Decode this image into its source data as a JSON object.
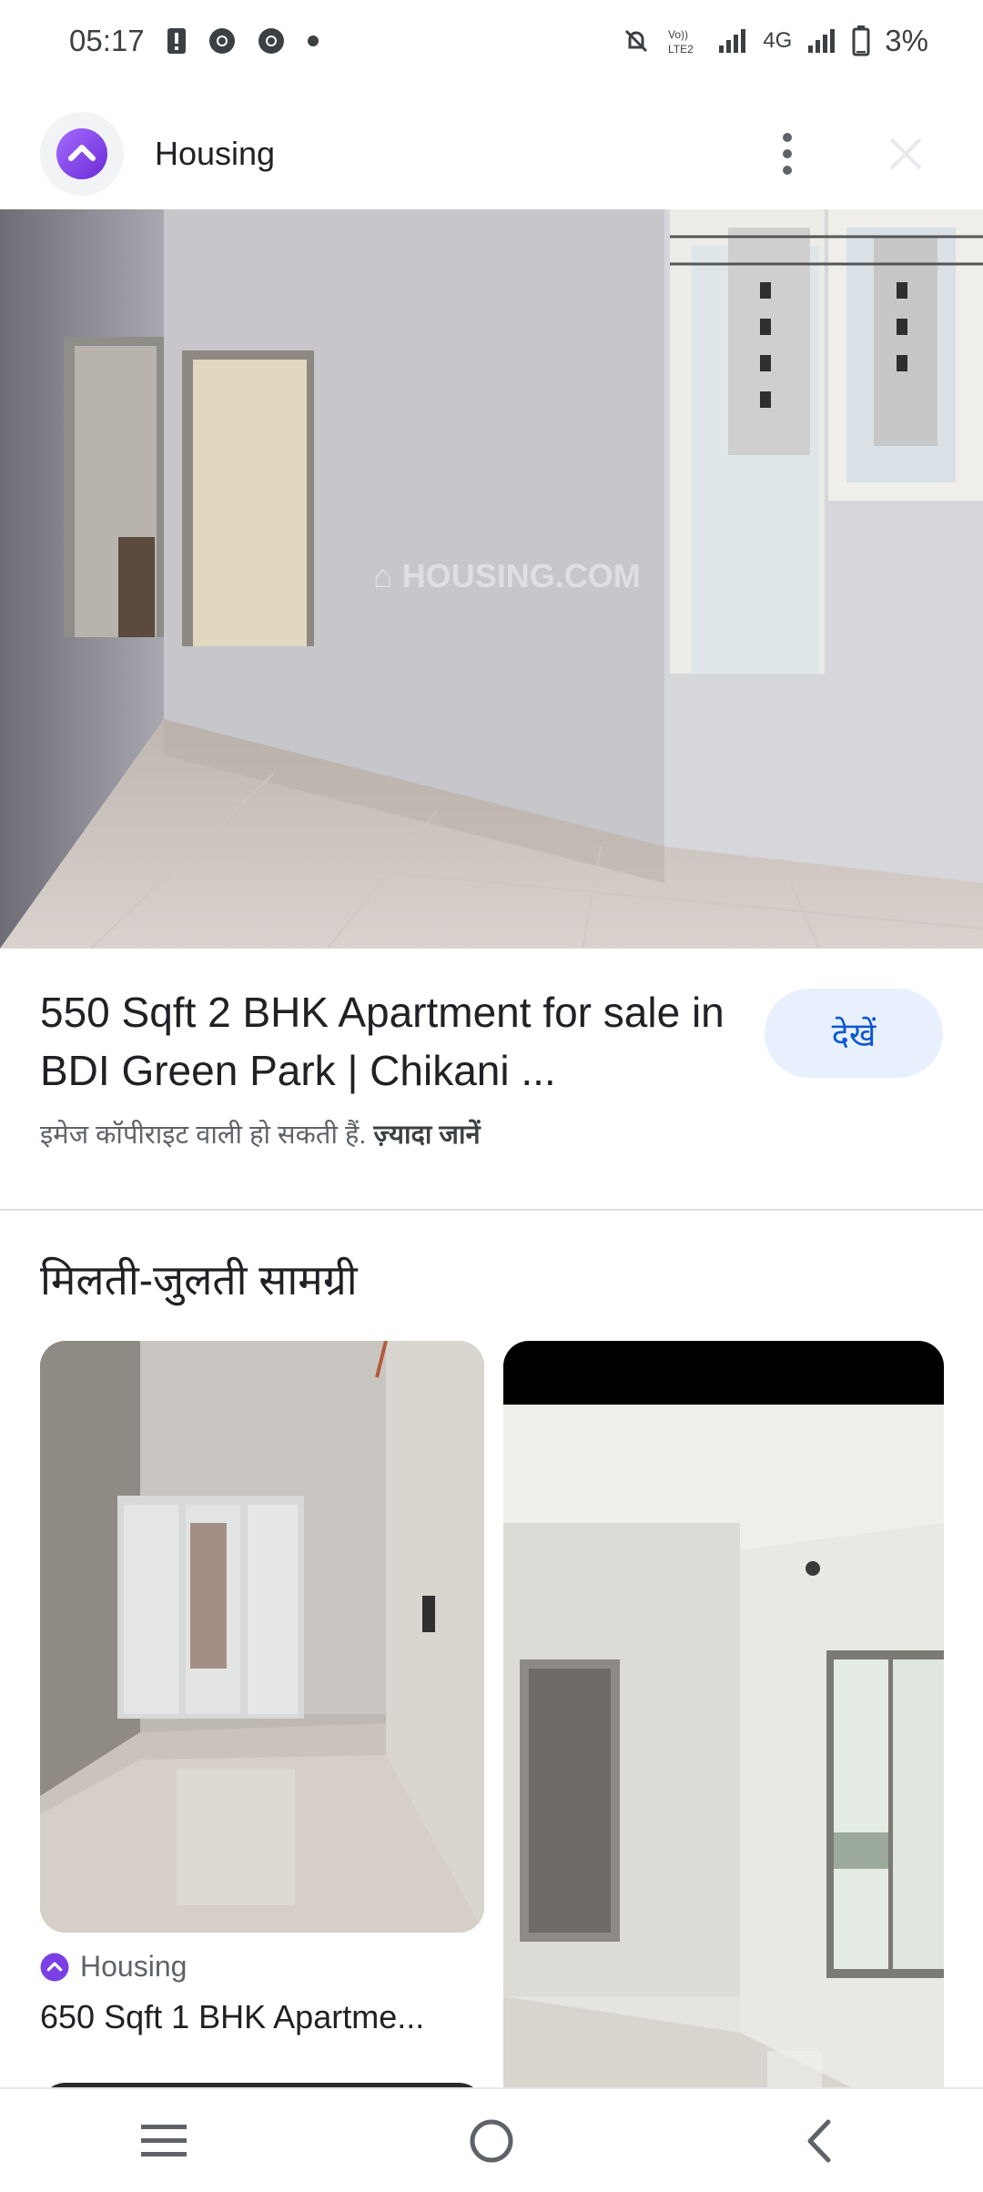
{
  "status_bar": {
    "time": "05:17",
    "network": "4G",
    "battery": "3%",
    "icons": [
      "alert-icon",
      "chrome-icon",
      "chrome-icon",
      "dot-icon",
      "mute-icon",
      "volte-icon",
      "signal-icon",
      "signal-icon",
      "battery-icon"
    ]
  },
  "header": {
    "app_name": "Housing",
    "more_icon": "more-vert-icon",
    "close_icon": "close-icon"
  },
  "hero": {
    "watermark": "HOUSING",
    "watermark_suffix": ".COM"
  },
  "listing": {
    "title": "550 Sqft 2 BHK Apartment for sale in BDI Green Park | Chikani ...",
    "view_button": "देखें",
    "copyright_text": "इमेज कॉपीराइट वाली हो सकती हैं.",
    "learn_more": "ज़्यादा जानें"
  },
  "similar": {
    "heading": "मिलती-जुलती सामग्री",
    "items": [
      {
        "source": "Housing",
        "caption": "650 Sqft 1 BHK Apartme..."
      }
    ]
  },
  "nav": {
    "recents_icon": "recents-icon",
    "home_icon": "home-icon",
    "back_icon": "back-icon"
  },
  "colors": {
    "brand_purple": "#7b3fe4",
    "button_bg": "#e8f0fe",
    "button_text": "#0b57d0"
  }
}
